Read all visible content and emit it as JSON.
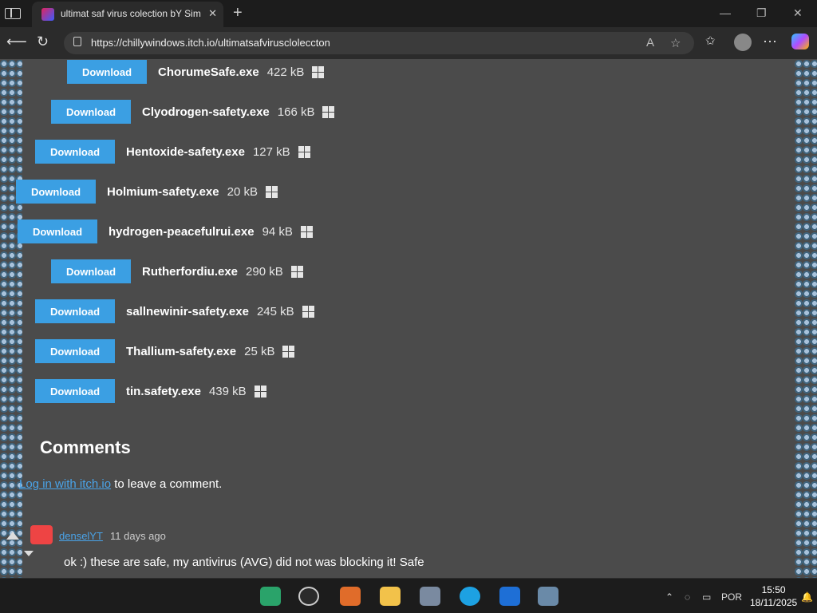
{
  "browser": {
    "tab_title": "ultimat saf virus colection bY Sim",
    "url": "https://chillywindows.itch.io/ultimatsafviruscloleccton",
    "read_aloud_label": "A"
  },
  "files": [
    {
      "button": "Download",
      "name": "ChorumeSafe.exe",
      "size": "422 kB"
    },
    {
      "button": "Download",
      "name": "Clyodrogen-safety.exe",
      "size": "166 kB"
    },
    {
      "button": "Download",
      "name": "Hentoxide-safety.exe",
      "size": "127 kB"
    },
    {
      "button": "Download",
      "name": "Holmium-safety.exe",
      "size": "20 kB"
    },
    {
      "button": "Download",
      "name": "hydrogen-peacefulrui.exe",
      "size": "94 kB"
    },
    {
      "button": "Download",
      "name": "Rutherfordiu.exe",
      "size": "290 kB"
    },
    {
      "button": "Download",
      "name": "sallnewinir-safety.exe",
      "size": "245 kB"
    },
    {
      "button": "Download",
      "name": "Thallium-safety.exe",
      "size": "25 kB"
    },
    {
      "button": "Download",
      "name": "tin.safety.exe",
      "size": "439 kB"
    }
  ],
  "comments": {
    "heading": "Comments",
    "login_link": "Log in with itch.io",
    "login_suffix": " to leave a comment.",
    "items": [
      {
        "user": "denselYT",
        "time": "11 days ago",
        "text": "ok :) these are safe, my antivirus (AVG) did not was blocking it! Safe"
      }
    ]
  },
  "taskbar": {
    "language": "POR",
    "time": "15:50",
    "date": "18/11/2025"
  },
  "colors": {
    "download_button": "#3b9fe3",
    "page_bg": "#4b4b4b",
    "link": "#4aa3e8"
  }
}
